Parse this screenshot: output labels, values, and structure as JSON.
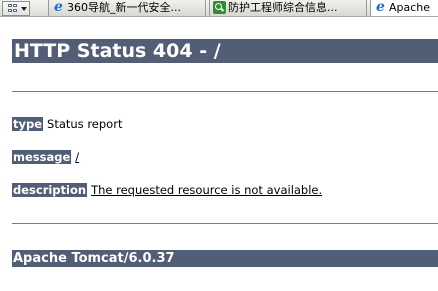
{
  "browser": {
    "tabs": [
      {
        "title": "360导航_新一代安全...",
        "icon": "ie-icon",
        "active": false
      },
      {
        "title": "防护工程师综合信息...",
        "icon": "search-icon",
        "active": false
      },
      {
        "title": "Apache",
        "icon": "ie-icon",
        "active": true
      }
    ]
  },
  "page": {
    "heading": "HTTP Status 404 - /",
    "type_label": "type",
    "type_value": "Status report",
    "message_label": "message",
    "message_value": "/",
    "description_label": "description",
    "description_value": "The requested resource is not available.",
    "footer": "Apache Tomcat/6.0.37"
  },
  "colors": {
    "heading_bg": "#525d76",
    "heading_text": "#ffffff"
  }
}
